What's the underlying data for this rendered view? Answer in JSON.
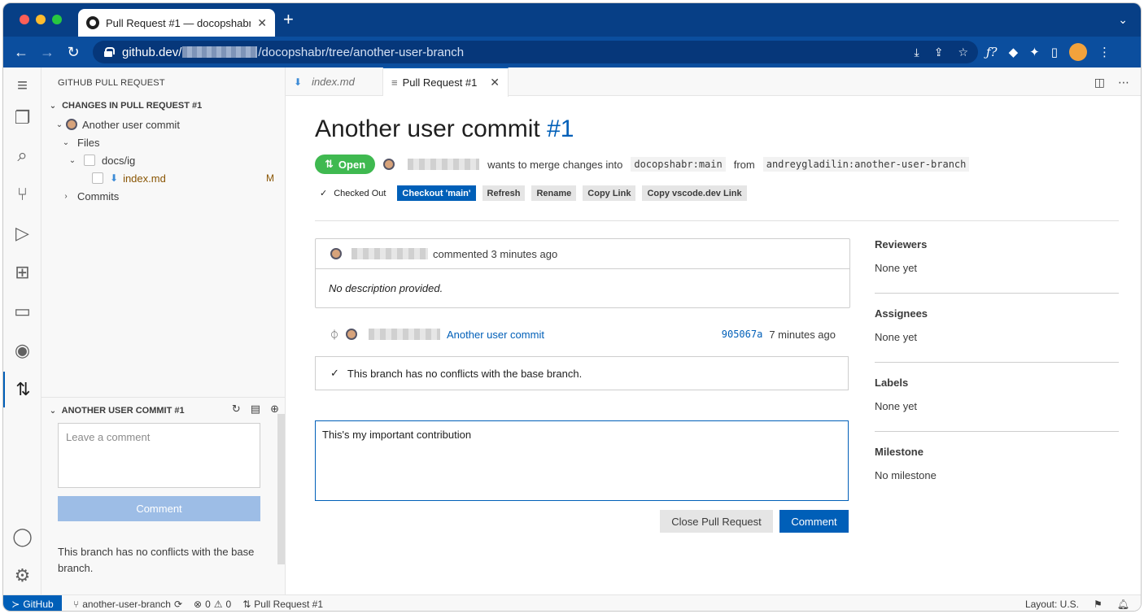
{
  "browser": {
    "tab_title": "Pull Request #1 — docopshabr",
    "new_tab": "+",
    "url_host": "github.dev/",
    "url_path": "/docopshabr/tree/another-user-branch"
  },
  "sidebar": {
    "title": "GITHUB PULL REQUEST",
    "section_title": "CHANGES IN PULL REQUEST #1",
    "commit_label": "Another user commit",
    "files_label": "Files",
    "folder_label": "docs/ig",
    "file_label": "index.md",
    "file_status": "M",
    "commits_label": "Commits",
    "lower_title": "ANOTHER USER COMMIT #1",
    "comment_placeholder": "Leave a comment",
    "comment_button": "Comment",
    "branch_note": "This branch has no conflicts with the base branch."
  },
  "editor": {
    "tabs": [
      {
        "label": "index.md"
      },
      {
        "label": "Pull Request #1"
      }
    ]
  },
  "pr": {
    "title": "Another user commit",
    "number": "#1",
    "state": "Open",
    "merge_text": "wants to merge changes into",
    "base_branch": "docopshabr:main",
    "from_text": "from",
    "head_branch": "andreygladilin:another-user-branch",
    "checked_out": "Checked Out",
    "buttons": {
      "checkout": "Checkout 'main'",
      "refresh": "Refresh",
      "rename": "Rename",
      "copy_link": "Copy Link",
      "copy_vscode_link": "Copy vscode.dev Link"
    },
    "comment_meta": "commented 3 minutes ago",
    "description": "No description provided.",
    "commit_message": "Another user commit",
    "commit_sha": "905067a",
    "commit_time": "7 minutes ago",
    "merge_status": "This branch has no conflicts with the base branch.",
    "comment_text": "This's my important contribution",
    "close_button": "Close Pull Request",
    "comment_button": "Comment"
  },
  "details": {
    "reviewers_label": "Reviewers",
    "reviewers_value": "None yet",
    "assignees_label": "Assignees",
    "assignees_value": "None yet",
    "labels_label": "Labels",
    "labels_value": "None yet",
    "milestone_label": "Milestone",
    "milestone_value": "No milestone"
  },
  "statusbar": {
    "remote": "GitHub",
    "branch": "another-user-branch",
    "errors": "0",
    "warnings": "0",
    "pr": "Pull Request #1",
    "layout": "Layout: U.S."
  },
  "colors": {
    "accent": "#005fb8",
    "open_badge": "#3fb950",
    "browser_chrome": "#0b4e9e"
  }
}
